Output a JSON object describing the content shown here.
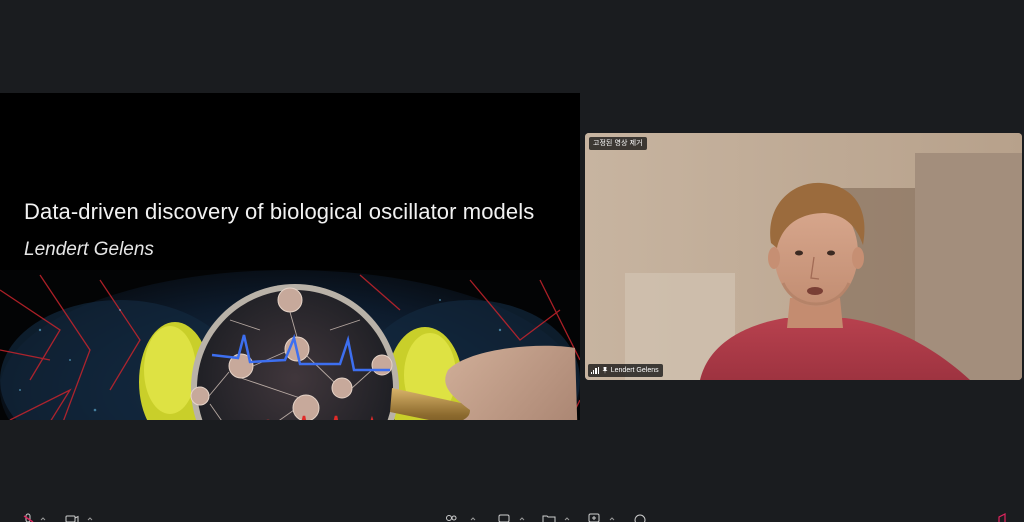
{
  "slide": {
    "title": "Data-driven discovery of biological oscillator models",
    "author": "Lendert Gelens"
  },
  "video": {
    "pin_label": "고정된 영상 제거",
    "participant_name": "Lendert Gelens"
  },
  "colors": {
    "background": "#1a1c1f",
    "slide_bg": "#000000",
    "accent": "#e0245e"
  },
  "icons": [
    "mic-icon",
    "video-camera-icon",
    "participants-icon",
    "chat-icon",
    "share-screen-icon",
    "reactions-icon",
    "more-icon",
    "leave-icon"
  ]
}
